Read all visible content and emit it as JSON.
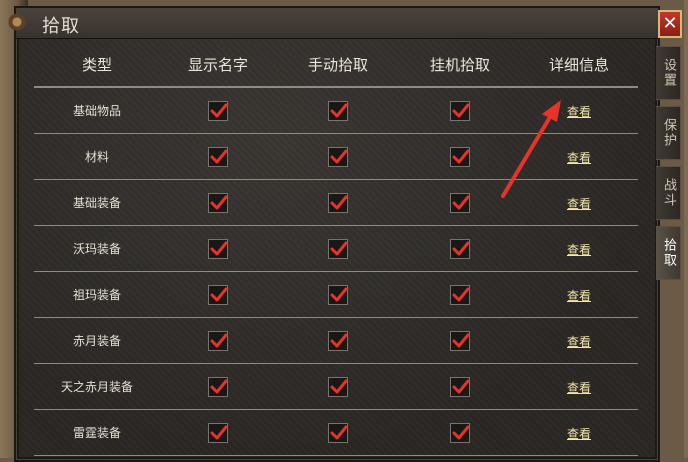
{
  "window": {
    "title": "拾取",
    "close_label": "✕"
  },
  "side_tabs": [
    "设置",
    "保护",
    "战斗",
    "拾取"
  ],
  "table": {
    "headers": [
      "类型",
      "显示名字",
      "手动拾取",
      "挂机拾取",
      "详细信息"
    ],
    "rows": [
      {
        "type": "基础物品",
        "show_name": true,
        "manual_pick": true,
        "auto_pick": true,
        "detail": "查看"
      },
      {
        "type": "材料",
        "show_name": true,
        "manual_pick": true,
        "auto_pick": true,
        "detail": "查看"
      },
      {
        "type": "基础装备",
        "show_name": true,
        "manual_pick": true,
        "auto_pick": true,
        "detail": "查看"
      },
      {
        "type": "沃玛装备",
        "show_name": true,
        "manual_pick": true,
        "auto_pick": true,
        "detail": "查看"
      },
      {
        "type": "祖玛装备",
        "show_name": true,
        "manual_pick": true,
        "auto_pick": true,
        "detail": "查看"
      },
      {
        "type": "赤月装备",
        "show_name": true,
        "manual_pick": true,
        "auto_pick": true,
        "detail": "查看"
      },
      {
        "type": "天之赤月装备",
        "show_name": true,
        "manual_pick": true,
        "auto_pick": true,
        "detail": "查看"
      },
      {
        "type": "雷霆装备",
        "show_name": true,
        "manual_pick": true,
        "auto_pick": true,
        "detail": "查看"
      }
    ]
  },
  "colors": {
    "check": "#e8322a",
    "link": "#f2e6a8",
    "arrow": "#e8322a"
  }
}
